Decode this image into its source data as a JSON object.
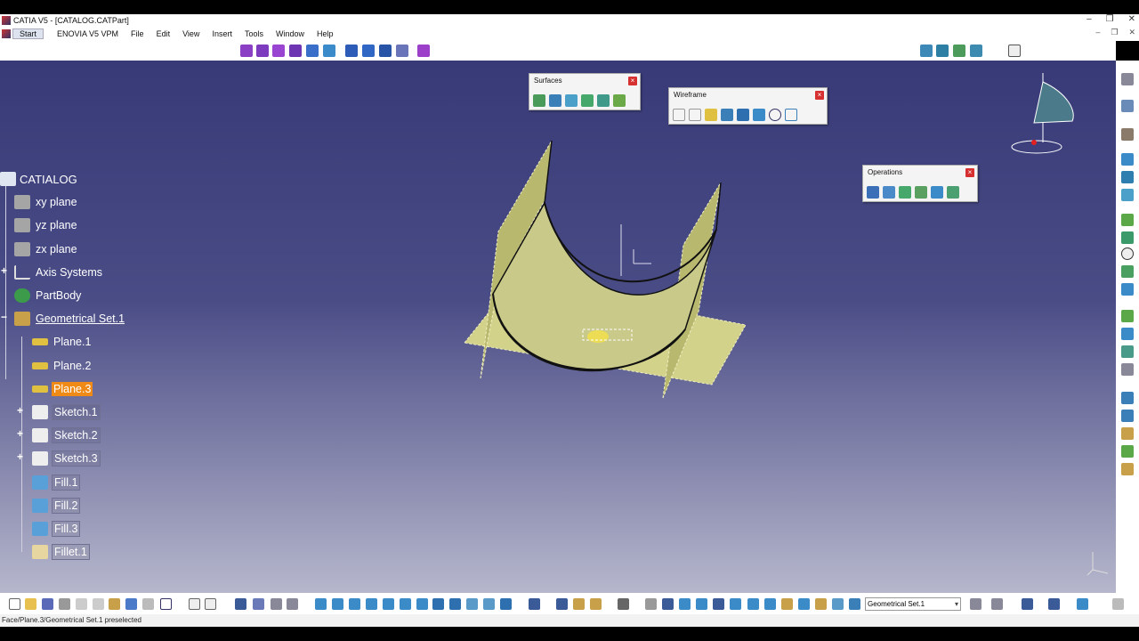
{
  "window": {
    "title": "CATIA V5 - [CATALOG.CATPart]",
    "controls": [
      "–",
      "❐",
      "✕"
    ]
  },
  "menu": {
    "items": [
      "Start",
      "ENOVIA V5 VPM",
      "File",
      "Edit",
      "View",
      "Insert",
      "Tools",
      "Window",
      "Help"
    ],
    "doc_controls": [
      "–",
      "❐",
      "✕"
    ]
  },
  "palettes": {
    "surfaces": {
      "title": "Surfaces",
      "close": "×"
    },
    "wireframe": {
      "title": "Wireframe",
      "close": "×"
    },
    "operations": {
      "title": "Operations",
      "close": "×"
    }
  },
  "tree": {
    "root": "CATIALOG",
    "nodes": [
      {
        "label": "xy plane",
        "icon": "plane-icon"
      },
      {
        "label": "yz plane",
        "icon": "plane-icon"
      },
      {
        "label": "zx plane",
        "icon": "plane-icon"
      },
      {
        "label": "Axis Systems",
        "icon": "axis-icon"
      },
      {
        "label": "PartBody",
        "icon": "gear-icon"
      },
      {
        "label": "Geometrical Set.1",
        "icon": "geoset-icon"
      },
      {
        "label": "Plane.1",
        "icon": "plane-icon"
      },
      {
        "label": "Plane.2",
        "icon": "plane-icon"
      },
      {
        "label": "Plane.3",
        "icon": "plane-icon",
        "selected": true
      },
      {
        "label": "Sketch.1",
        "icon": "sketch-icon"
      },
      {
        "label": "Sketch.2",
        "icon": "sketch-icon"
      },
      {
        "label": "Sketch.3",
        "icon": "sketch-icon"
      },
      {
        "label": "Fill.1",
        "icon": "fill-icon"
      },
      {
        "label": "Fill.2",
        "icon": "fill-icon"
      },
      {
        "label": "Fill.3",
        "icon": "fill-icon"
      },
      {
        "label": "Fillet.1",
        "icon": "fillet-icon"
      }
    ]
  },
  "bottom": {
    "current_set": "Geometrical Set.1"
  },
  "status": {
    "text": "Face/Plane.3/Geometrical Set.1 preselected"
  },
  "colors": {
    "selection": "#f08a17",
    "geometry": "#d6d68a",
    "viewport_top": "#383a78"
  }
}
